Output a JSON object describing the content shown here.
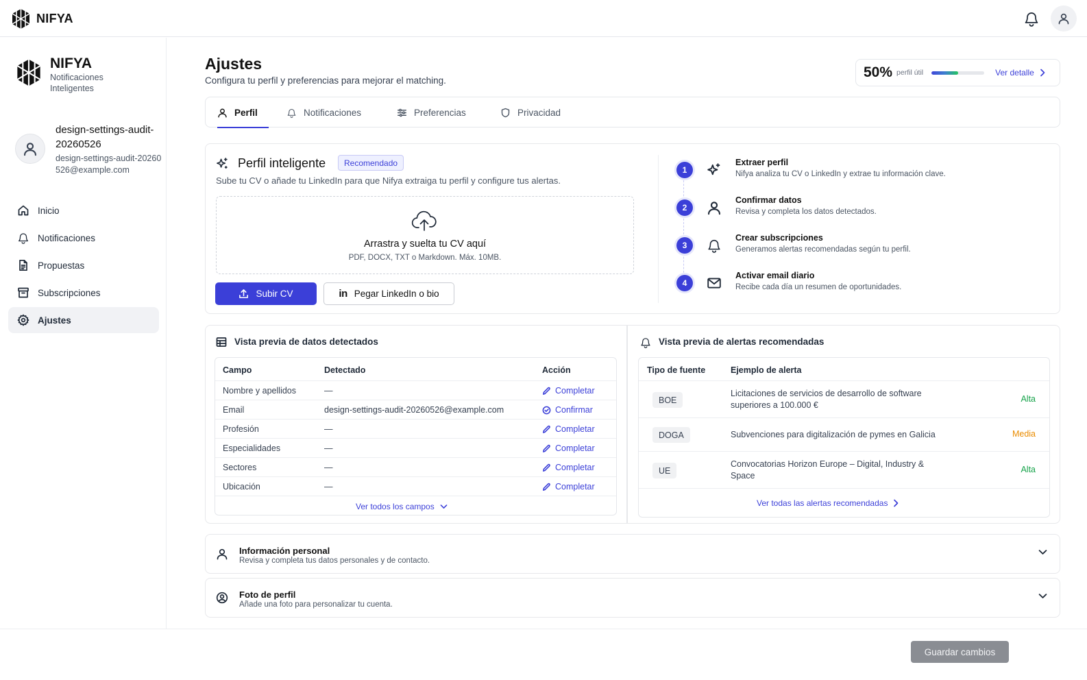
{
  "app": {
    "brand": "NIFYA",
    "tagline": "Notificaciones Inteligentes"
  },
  "colors": {
    "accent": "#3b3fd8",
    "high": "#16a34a",
    "medium": "#ea8c00",
    "save_disabled": "#8a8d93"
  },
  "icons": {
    "logo": "hex-logo-icon",
    "bell": "bell-icon",
    "user": "user-icon"
  },
  "user": {
    "name_line1": "design-settings-audit-",
    "name_line2": "20260526",
    "email": "design-settings-audit-20260526@example.com"
  },
  "nav": [
    {
      "label": "Inicio",
      "icon": "home-icon"
    },
    {
      "label": "Notificaciones",
      "icon": "bell-icon"
    },
    {
      "label": "Propuestas",
      "icon": "document-icon"
    },
    {
      "label": "Subscripciones",
      "icon": "archive-icon"
    },
    {
      "label": "Ajustes",
      "icon": "gear-icon",
      "active": true
    }
  ],
  "page": {
    "title": "Ajustes",
    "subtitle": "Configura tu perfil y preferencias para mejorar el matching."
  },
  "utility": {
    "percent": "50%",
    "progress": 0.5,
    "label": "perfil útil",
    "link": "Ver detalle"
  },
  "tabs": [
    {
      "label": "Perfil",
      "icon": "user-icon",
      "active": true
    },
    {
      "label": "Notificaciones",
      "icon": "bell-icon"
    },
    {
      "label": "Preferencias",
      "icon": "sliders-icon"
    },
    {
      "label": "Privacidad",
      "icon": "shield-icon"
    }
  ],
  "smart_profile": {
    "title": "Perfil inteligente",
    "badge": "Recomendado",
    "subtitle": "Sube tu CV o añade tu LinkedIn para que Nifya extraiga tu perfil y configure tus alertas.",
    "drop_title": "Arrastra y suelta tu CV aquí",
    "drop_sub": "PDF, DOCX, TXT o Markdown. Máx. 10MB.",
    "upload_btn": "Subir CV",
    "linkedin_btn": "Pegar LinkedIn o bio"
  },
  "steps": [
    {
      "num": "1",
      "title": "Extraer perfil",
      "desc": "Nifya analiza tu CV o LinkedIn y extrae tu información clave.",
      "icon": "sparkle-icon"
    },
    {
      "num": "2",
      "title": "Confirmar datos",
      "desc": "Revisa y completa los datos detectados.",
      "icon": "user-icon"
    },
    {
      "num": "3",
      "title": "Crear subscripciones",
      "desc": "Generamos alertas recomendadas según tu perfil.",
      "icon": "bell-icon"
    },
    {
      "num": "4",
      "title": "Activar email diario",
      "desc": "Recibe cada día un resumen de oportunidades.",
      "icon": "mail-icon"
    }
  ],
  "detected": {
    "title": "Vista previa de datos detectados",
    "headers": [
      "Campo",
      "Detectado",
      "Acción"
    ],
    "rows": [
      {
        "field": "Nombre y apellidos",
        "value": "—",
        "action": "Completar",
        "action_icon": "pencil-icon"
      },
      {
        "field": "Email",
        "value": "design-settings-audit-20260526@example.com",
        "action": "Confirmar",
        "action_icon": "check-circle-icon"
      },
      {
        "field": "Profesión",
        "value": "—",
        "action": "Completar",
        "action_icon": "pencil-icon"
      },
      {
        "field": "Especialidades",
        "value": "—",
        "action": "Completar",
        "action_icon": "pencil-icon"
      },
      {
        "field": "Sectores",
        "value": "—",
        "action": "Completar",
        "action_icon": "pencil-icon"
      },
      {
        "field": "Ubicación",
        "value": "—",
        "action": "Completar",
        "action_icon": "pencil-icon"
      }
    ],
    "more": "Ver todos los campos"
  },
  "alerts": {
    "title": "Vista previa de alertas recomendadas",
    "headers": [
      "Tipo de fuente",
      "Ejemplo de alerta"
    ],
    "rows": [
      {
        "source": "BOE",
        "text": "Licitaciones de servicios de desarrollo de software superiores a 100.000 €",
        "priority": "Alta",
        "level": "high"
      },
      {
        "source": "DOGA",
        "text": "Subvenciones para digitalización de pymes en Galicia",
        "priority": "Media",
        "level": "medium"
      },
      {
        "source": "UE",
        "text": "Convocatorias Horizon Europe – Digital, Industry & Space",
        "priority": "Alta",
        "level": "high"
      }
    ],
    "more": "Ver todas las alertas recomendadas"
  },
  "accordions": [
    {
      "title": "Información personal",
      "subtitle": "Revisa y completa tus datos personales y de contacto.",
      "icon": "user-icon"
    },
    {
      "title": "Foto de perfil",
      "subtitle": "Añade una foto para personalizar tu cuenta.",
      "icon": "user-circle-icon"
    }
  ],
  "footer": {
    "save": "Guardar cambios"
  }
}
